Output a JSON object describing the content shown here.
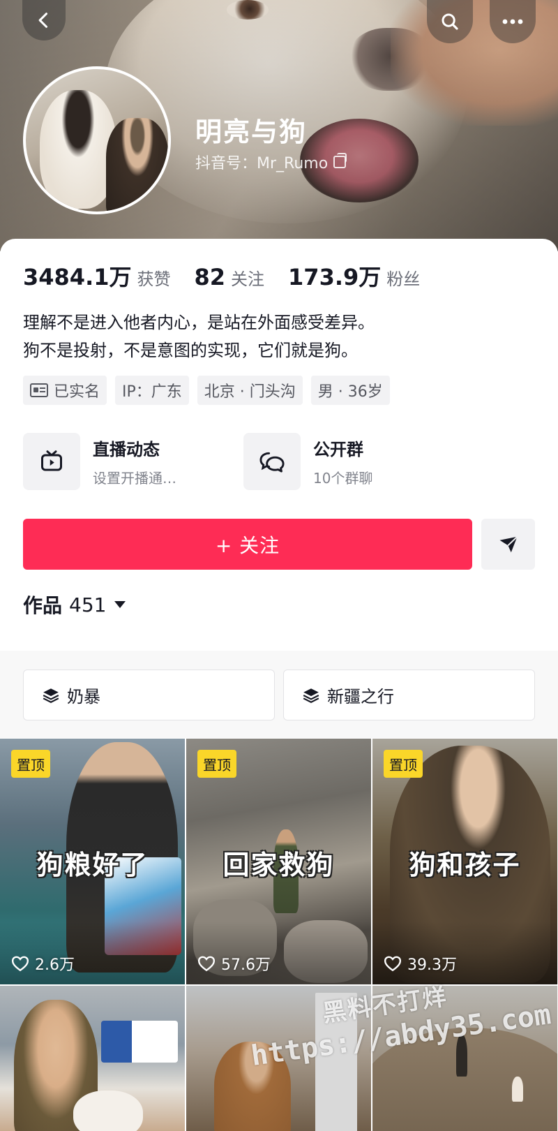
{
  "profile": {
    "nickname": "明亮与狗",
    "douyin_id": "抖音号：Mr_Rumo"
  },
  "stats": [
    {
      "num": "3484.1万",
      "label": "获赞"
    },
    {
      "num": "82",
      "label": "关注"
    },
    {
      "num": "173.9万",
      "label": "粉丝"
    }
  ],
  "bio": {
    "line1": "理解不是进入他者内心，是站在外面感受差异。",
    "line2": "狗不是投射，不是意图的实现，它们就是狗。"
  },
  "tags": {
    "verified": "已实名",
    "ip": "IP：广东",
    "location": "北京 · 门头沟",
    "gender_age": "男 · 36岁"
  },
  "features": {
    "live": {
      "title": "直播动态",
      "sub": "设置开播通…"
    },
    "group": {
      "title": "公开群",
      "sub": "10个群聊"
    }
  },
  "actions": {
    "follow": "+ 关注"
  },
  "works": {
    "label": "作品",
    "count": "451"
  },
  "collections": [
    "奶暴",
    "新疆之行"
  ],
  "videos": [
    {
      "pinned": "置顶",
      "title": "狗粮好了",
      "likes": "2.6万"
    },
    {
      "pinned": "置顶",
      "title": "回家救狗",
      "likes": "57.6万"
    },
    {
      "pinned": "置顶",
      "title": "狗和孩子",
      "likes": "39.3万"
    }
  ],
  "watermark": {
    "line1": "黑料不打烊",
    "line2": "https://abdy35.com"
  },
  "colors": {
    "accent": "#fe2c55",
    "pin_badge": "#fad629"
  },
  "icons": [
    "back-icon",
    "search-icon",
    "more-icon",
    "copy-icon",
    "idcard-icon",
    "live-tv-icon",
    "group-chat-icon",
    "share-send-icon",
    "caret-down-icon",
    "layers-icon",
    "heart-icon"
  ]
}
